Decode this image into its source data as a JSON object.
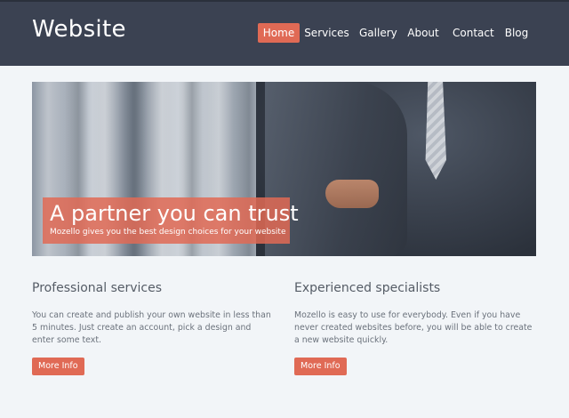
{
  "header": {
    "logo": "Website"
  },
  "nav": {
    "items": [
      {
        "label": "Home",
        "active": true
      },
      {
        "label": "Services",
        "active": false
      },
      {
        "label": "Gallery",
        "active": false
      },
      {
        "label": "About",
        "active": false
      },
      {
        "label": "Contact",
        "active": false
      },
      {
        "label": "Blog",
        "active": false
      }
    ]
  },
  "hero": {
    "title": "A partner you can trust",
    "subtitle": "Mozello gives you the best design choices for your website"
  },
  "columns": [
    {
      "heading": "Professional services",
      "text": "You can create and publish your own website in less than 5 minutes. Just create an account, pick a design and enter some text.",
      "button": "More Info"
    },
    {
      "heading": "Experienced specialists",
      "text": "Mozello is easy to use for everybody. Even if you have never created websites before, you will be able to create a new website quickly.",
      "button": "More Info"
    }
  ],
  "colors": {
    "header_bg": "#3b4252",
    "accent": "#e06a55",
    "page_bg": "#f2f5f8"
  }
}
